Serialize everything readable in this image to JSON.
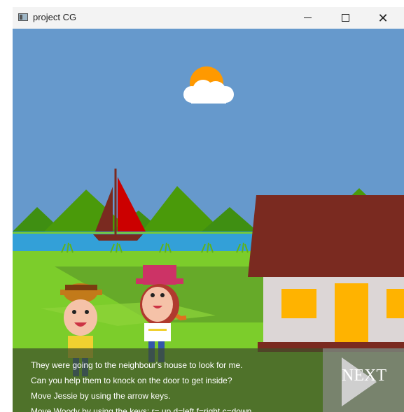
{
  "window": {
    "title": "project CG",
    "controls": {
      "minimize_icon": "minimize-icon",
      "maximize_icon": "maximize-icon",
      "close_icon": "close-icon"
    }
  },
  "scene": {
    "dialog": {
      "lines": [
        "They were going to the neighbour's house to look for me.",
        "Can you help them to knock on the door to get inside?",
        "Move Jessie by using the arrow keys.",
        "Move Woody by using the keys: r= up,d=left,f=right,c=down"
      ]
    },
    "next_button": {
      "label": "NEXT",
      "icon": "play-triangle-icon"
    },
    "colors": {
      "sky": "#6699cc",
      "sun": "#ff9900",
      "mountains": "#4a9a0a",
      "water": "#33a0d8",
      "grass": "#7ccd2b",
      "roof": "#7a2a20",
      "wall": "#dcd6d6",
      "windows": "#ffb300",
      "sail": "#cc0000"
    }
  }
}
